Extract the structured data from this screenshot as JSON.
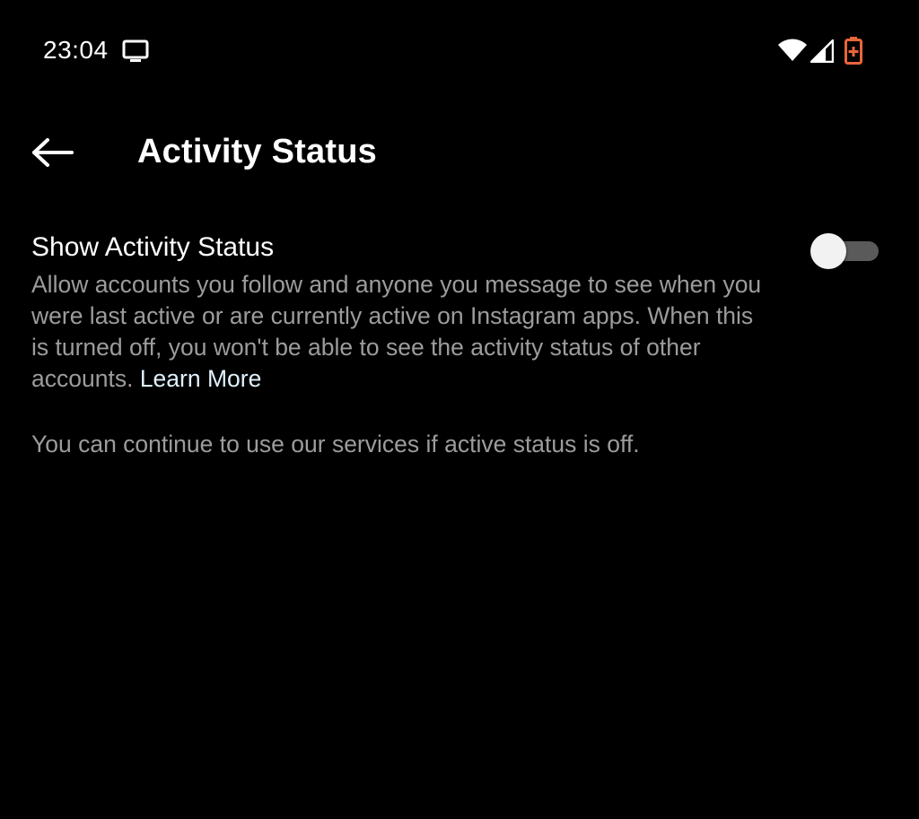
{
  "status_bar": {
    "time": "23:04",
    "icons": [
      "cast-icon",
      "wifi-icon",
      "signal-icon",
      "battery-charging-icon"
    ],
    "battery_color": "#e8663a"
  },
  "header": {
    "back_icon": "arrow-left-icon",
    "title": "Activity Status"
  },
  "setting": {
    "title": "Show Activity Status",
    "description": "Allow accounts you follow and anyone you message to see when you were last active or are currently active on Instagram apps. When this is turned off, you won't be able to see the activity status of other accounts.",
    "learn_more": "Learn More",
    "toggle_on": false
  },
  "footnote": "You can continue to use our services if active status is off.",
  "colors": {
    "background": "#000000",
    "primary_text": "#ffffff",
    "secondary_text": "#9c9c9c",
    "link": "#e0f1ff"
  }
}
